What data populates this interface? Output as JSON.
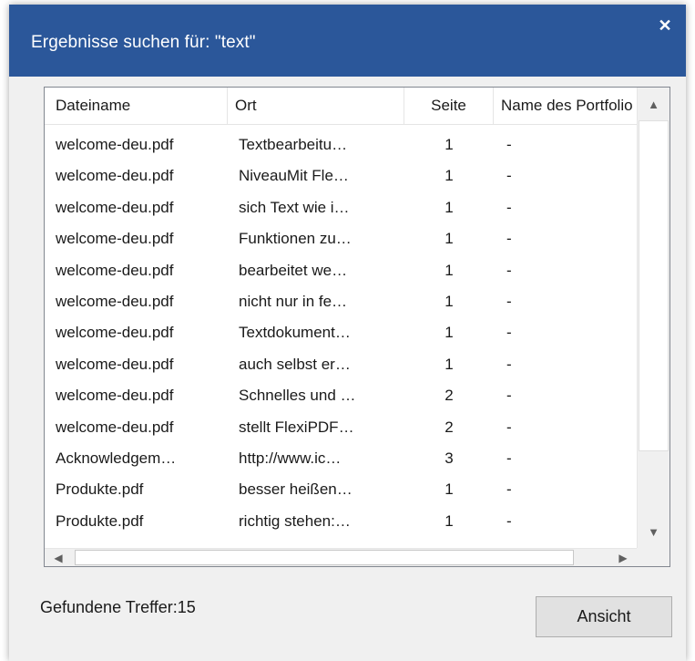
{
  "dialog": {
    "title": "Ergebnisse suchen für: \"text\"",
    "close_glyph": "✕"
  },
  "columns": {
    "file": "Dateiname",
    "location": "Ort",
    "page": "Seite",
    "portfolio": "Name des Portfolio"
  },
  "results": [
    {
      "file": "welcome-deu.pdf",
      "location": "Textbearbeitu…",
      "page": "1",
      "portfolio": "-"
    },
    {
      "file": "welcome-deu.pdf",
      "location": " NiveauMit Fle…",
      "page": "1",
      "portfolio": "-"
    },
    {
      "file": "welcome-deu.pdf",
      "location": " sich Text wie i…",
      "page": "1",
      "portfolio": "-"
    },
    {
      "file": "welcome-deu.pdf",
      "location": " Funktionen zu…",
      "page": "1",
      "portfolio": "-"
    },
    {
      "file": "welcome-deu.pdf",
      "location": " bearbeitet we…",
      "page": "1",
      "portfolio": "-"
    },
    {
      "file": "welcome-deu.pdf",
      "location": " nicht nur in fe…",
      "page": "1",
      "portfolio": "-"
    },
    {
      "file": "welcome-deu.pdf",
      "location": " Textdokument…",
      "page": "1",
      "portfolio": "-"
    },
    {
      "file": "welcome-deu.pdf",
      "location": " auch selbst er…",
      "page": "1",
      "portfolio": "-"
    },
    {
      "file": "welcome-deu.pdf",
      "location": "Schnelles und …",
      "page": "2",
      "portfolio": "-"
    },
    {
      "file": "welcome-deu.pdf",
      "location": " stellt FlexiPDF…",
      "page": "2",
      "portfolio": "-"
    },
    {
      "file": "Acknowledgem…",
      "location": " http://www.ic…",
      "page": "3",
      "portfolio": "-"
    },
    {
      "file": "Produkte.pdf",
      "location": " besser heißen…",
      "page": "1",
      "portfolio": "-"
    },
    {
      "file": "Produkte.pdf",
      "location": " richtig stehen:…",
      "page": "1",
      "portfolio": "-"
    }
  ],
  "scrollbar": {
    "up_icon": "▲",
    "down_icon": "▼",
    "left_icon": "◀",
    "right_icon": "▶"
  },
  "status": {
    "hits_label": "Gefundene Treffer:15"
  },
  "buttons": {
    "view_label": "Ansicht"
  },
  "colors": {
    "titlebar": "#2b579a",
    "dialog_background": "#f0f0f0"
  }
}
